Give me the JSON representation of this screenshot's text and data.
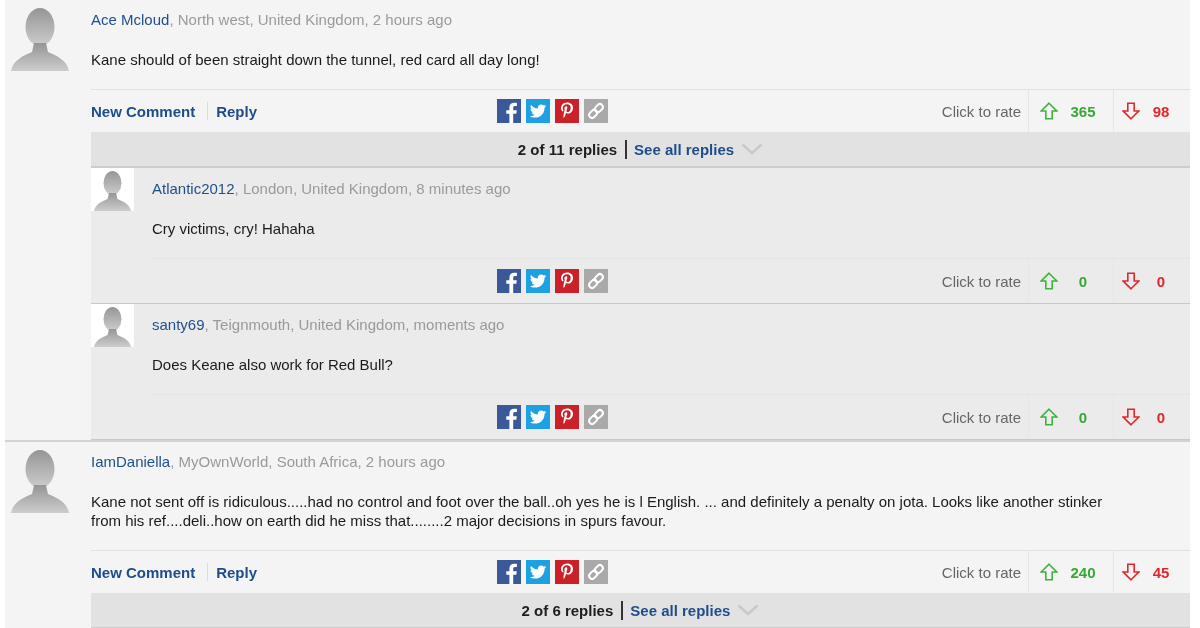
{
  "comments": [
    {
      "author": "Ace Mcloud",
      "details": ", North west, United Kingdom, 2 hours ago",
      "text": "Kane should of been straight down the tunnel, red card all day long!",
      "actions": [
        "New Comment",
        "Reply"
      ],
      "rate_label": "Click to rate",
      "up_votes": "365",
      "down_votes": "98",
      "replies_bar": {
        "count": "2 of 11 replies",
        "link": "See all replies"
      },
      "replies": [
        {
          "author": "Atlantic2012",
          "details": ", London, United Kingdom, 8 minutes ago",
          "text": "Cry victims, cry! Hahaha",
          "rate_label": "Click to rate",
          "up_votes": "0",
          "down_votes": "0"
        },
        {
          "author": "santy69",
          "details": ", Teignmouth, United Kingdom, moments ago",
          "text": "Does Keane also work for Red Bull?",
          "rate_label": "Click to rate",
          "up_votes": "0",
          "down_votes": "0"
        }
      ]
    },
    {
      "author": "IamDaniella",
      "details": ", MyOwnWorld, South Africa, 2 hours ago",
      "text": "Kane not sent off is ridiculous.....had no control and foot over the ball..oh yes he is l English. ... and definitely a penalty on jota. Looks like another stinker from his ref....deli..how on earth did he miss that........2 major decisions in spurs favour.",
      "actions": [
        "New Comment",
        "Reply"
      ],
      "rate_label": "Click to rate",
      "up_votes": "240",
      "down_votes": "45",
      "replies_bar": {
        "count": "2 of 6 replies",
        "link": "See all replies"
      }
    }
  ]
}
